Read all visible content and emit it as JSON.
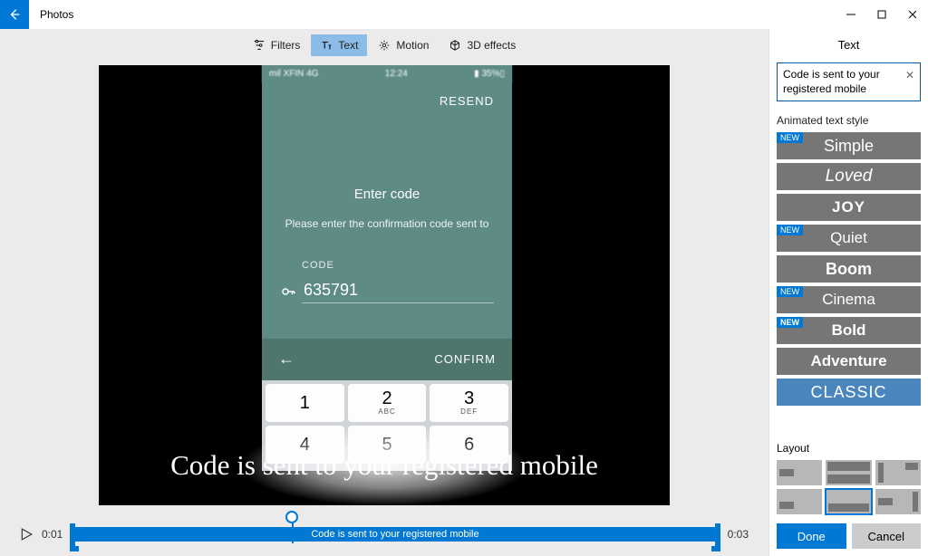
{
  "app": {
    "title": "Photos"
  },
  "toolbar": {
    "filters": "Filters",
    "text": "Text",
    "motion": "Motion",
    "effects": "3D effects"
  },
  "preview": {
    "phone": {
      "status_left": "mil XFIN  4G",
      "status_time": "12:24",
      "resend": "RESEND",
      "enter_code": "Enter code",
      "subtext": "Please enter the confirmation code sent to",
      "code_label": "CODE",
      "code_value": "635791",
      "confirm": "CONFIRM",
      "keys": [
        {
          "n": "1",
          "l": ""
        },
        {
          "n": "2",
          "l": "ABC"
        },
        {
          "n": "3",
          "l": "DEF"
        },
        {
          "n": "4",
          "l": ""
        },
        {
          "n": "5",
          "l": ""
        },
        {
          "n": "6",
          "l": ""
        }
      ]
    },
    "overlay_text": "Code is sent to your registered mobile"
  },
  "timeline": {
    "start": "0:01",
    "end": "0:03",
    "clip_label": "Code is sent to your registered mobile"
  },
  "side": {
    "title": "Text",
    "input_value": "Code is sent to your registered mobile",
    "section_style": "Animated text style",
    "styles": [
      {
        "label": "Simple",
        "cls": "s-simple",
        "new": true
      },
      {
        "label": "Loved",
        "cls": "s-loved",
        "new": false
      },
      {
        "label": "JOY",
        "cls": "s-joy",
        "new": false
      },
      {
        "label": "Quiet",
        "cls": "s-quiet",
        "new": true
      },
      {
        "label": "Boom",
        "cls": "s-boom",
        "new": false
      },
      {
        "label": "Cinema",
        "cls": "s-cinema",
        "new": true
      },
      {
        "label": "Bold",
        "cls": "s-bold",
        "new": true
      },
      {
        "label": "Adventure",
        "cls": "s-adventure",
        "new": false
      },
      {
        "label": "CLASSIC",
        "cls": "s-classic",
        "new": false,
        "selected": true
      }
    ],
    "section_layout": "Layout",
    "new_label": "NEW",
    "done": "Done",
    "cancel": "Cancel"
  }
}
